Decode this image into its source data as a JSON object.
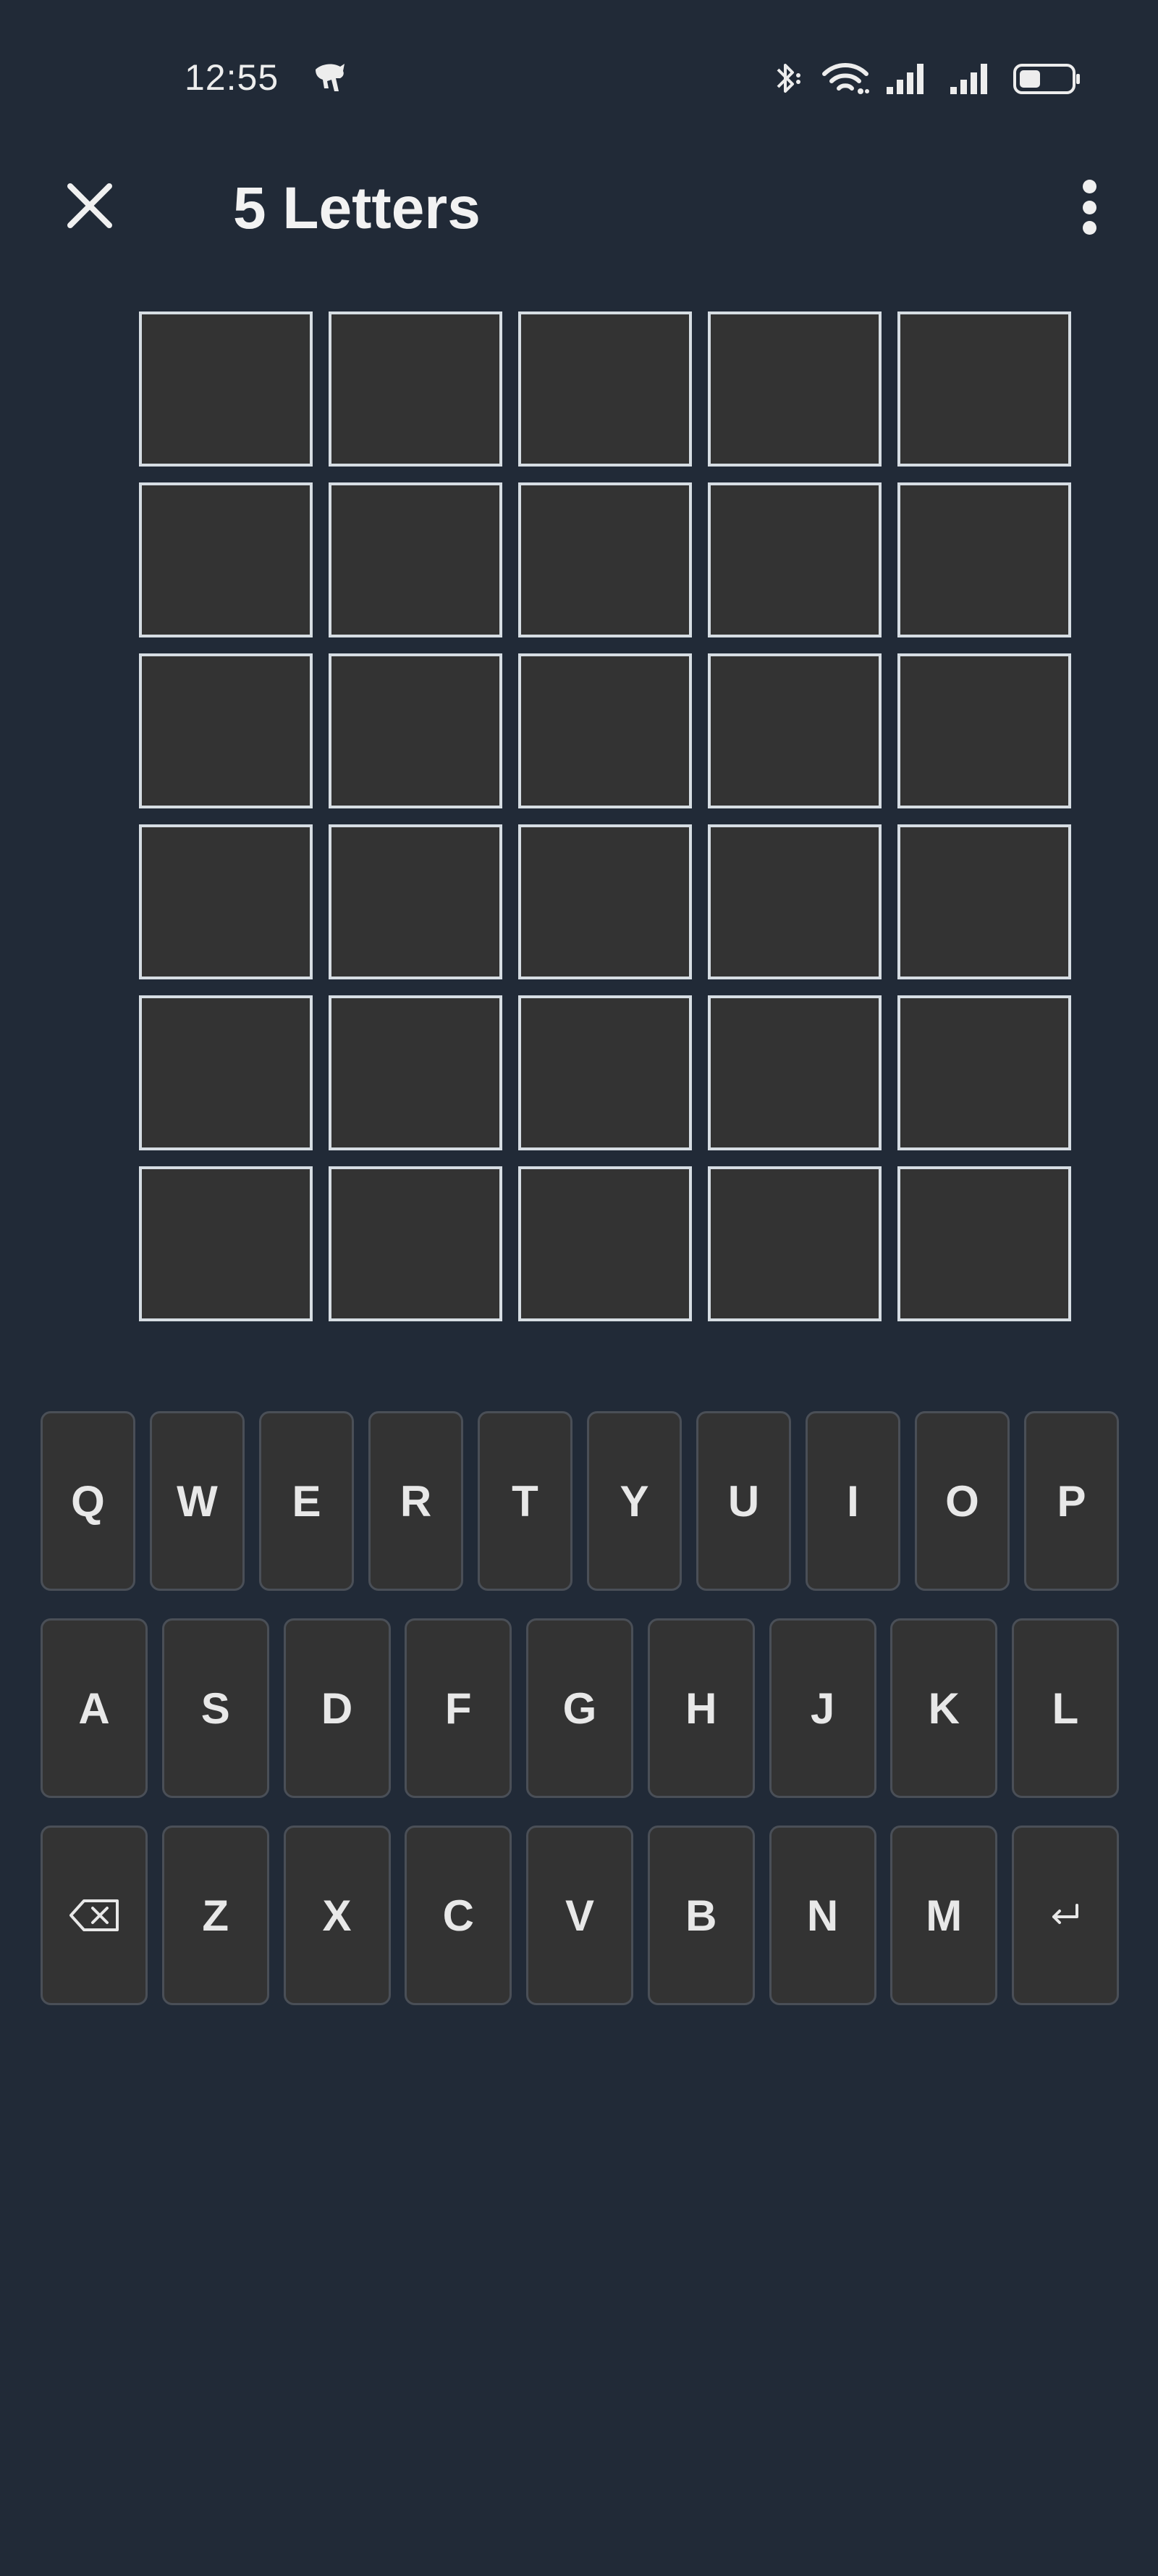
{
  "status_bar": {
    "time": "12:55",
    "app_icon": "app-notification-icon",
    "icons": [
      "bluetooth-icon",
      "wifi-icon",
      "signal-icon",
      "signal-icon",
      "battery-icon"
    ]
  },
  "app_bar": {
    "close_icon": "close-icon",
    "title": "5 Letters",
    "menu_icon": "more-vert-icon"
  },
  "board": {
    "rows": 6,
    "columns": 5,
    "cells": [
      [
        "",
        "",
        "",
        "",
        ""
      ],
      [
        "",
        "",
        "",
        "",
        ""
      ],
      [
        "",
        "",
        "",
        "",
        ""
      ],
      [
        "",
        "",
        "",
        "",
        ""
      ],
      [
        "",
        "",
        "",
        "",
        ""
      ],
      [
        "",
        "",
        "",
        "",
        ""
      ]
    ]
  },
  "keyboard": {
    "row1": [
      "Q",
      "W",
      "E",
      "R",
      "T",
      "Y",
      "U",
      "I",
      "O",
      "P"
    ],
    "row2": [
      "A",
      "S",
      "D",
      "F",
      "G",
      "H",
      "J",
      "K",
      "L"
    ],
    "row3_letters": [
      "Z",
      "X",
      "C",
      "V",
      "B",
      "N",
      "M"
    ],
    "backspace_icon": "backspace-icon",
    "enter_icon": "enter-icon"
  },
  "colors": {
    "background": "#212a37",
    "tile": "#333333",
    "tile_border": "#d6dde3",
    "key": "#333333",
    "key_border": "#4a4f57"
  }
}
